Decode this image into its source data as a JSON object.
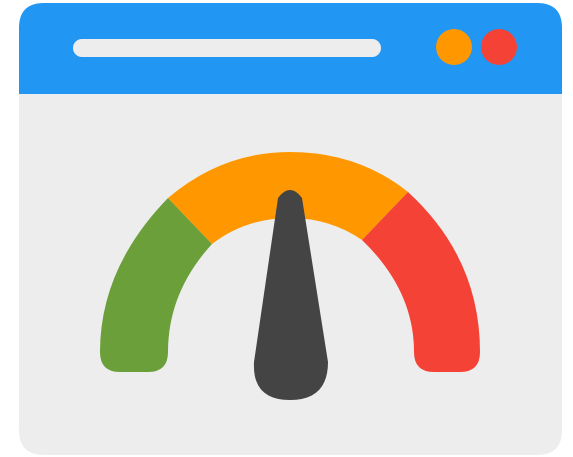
{
  "colors": {
    "titlebar": "#2196F3",
    "window_body": "#EDEDED",
    "address_bar": "#EDEDED",
    "dot_left": "#FF9800",
    "dot_right": "#F44336",
    "gauge_low": "#6A9F3A",
    "gauge_mid": "#FF9800",
    "gauge_high": "#F44336",
    "needle": "#444444"
  },
  "window": {
    "address_bar_icon": "address-bar",
    "controls": [
      "minimize-dot",
      "close-dot"
    ]
  },
  "gauge": {
    "icon": "speedometer-icon",
    "segments": [
      "low",
      "medium",
      "high"
    ],
    "needle_position": "center"
  }
}
